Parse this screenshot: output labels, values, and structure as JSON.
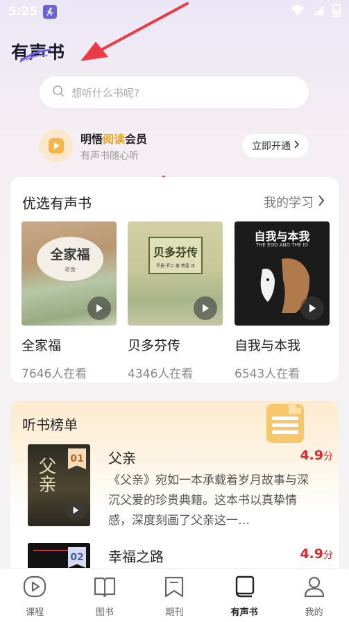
{
  "status": {
    "time": "5:25"
  },
  "header": {
    "title": "有声书"
  },
  "search": {
    "placeholder": "想听什么书呢?"
  },
  "vip": {
    "title_prefix": "明悟",
    "title_highlight": "阅读",
    "title_suffix": "会员",
    "subtitle": "有声书随心听",
    "button_label": "立即开通",
    "highlight_color": "#f0a21c"
  },
  "featured": {
    "title": "优选有声书",
    "link_label": "我的学习",
    "books": [
      {
        "title": "全家福",
        "viewers": "7646人在看",
        "cover_text": "全家福",
        "cover_sub": "老舍"
      },
      {
        "title": "贝多芬传",
        "viewers": "4346人在看",
        "cover_text": "贝多芬传",
        "cover_sub": "罗曼·罗兰 著 傅雷 译"
      },
      {
        "title": "自我与本我",
        "viewers": "6543人在看",
        "cover_text": "自我与本我",
        "cover_sub": "THE EGO AND THE ID"
      }
    ]
  },
  "ranking": {
    "title": "听书榜单",
    "items": [
      {
        "rank": "01",
        "name": "父亲",
        "score": "4.9",
        "score_unit": "分",
        "description": "《父亲》宛如一本承载着岁月故事与深沉父爱的珍贵典籍。这本书以真挚情感，深度刻画了父亲这一…",
        "cover_text": "父亲"
      },
      {
        "rank": "02",
        "name": "幸福之路",
        "score": "4.9",
        "score_unit": "分"
      }
    ]
  },
  "tabbar": {
    "tabs": [
      {
        "label": "课程",
        "icon": "course-icon"
      },
      {
        "label": "图书",
        "icon": "book-icon"
      },
      {
        "label": "期刊",
        "icon": "journal-icon"
      },
      {
        "label": "有声书",
        "icon": "audiobook-icon",
        "active": true
      },
      {
        "label": "我的",
        "icon": "profile-icon"
      }
    ]
  },
  "colors": {
    "score": "#e0282d",
    "annotation_arrow": "#ec3b47"
  }
}
